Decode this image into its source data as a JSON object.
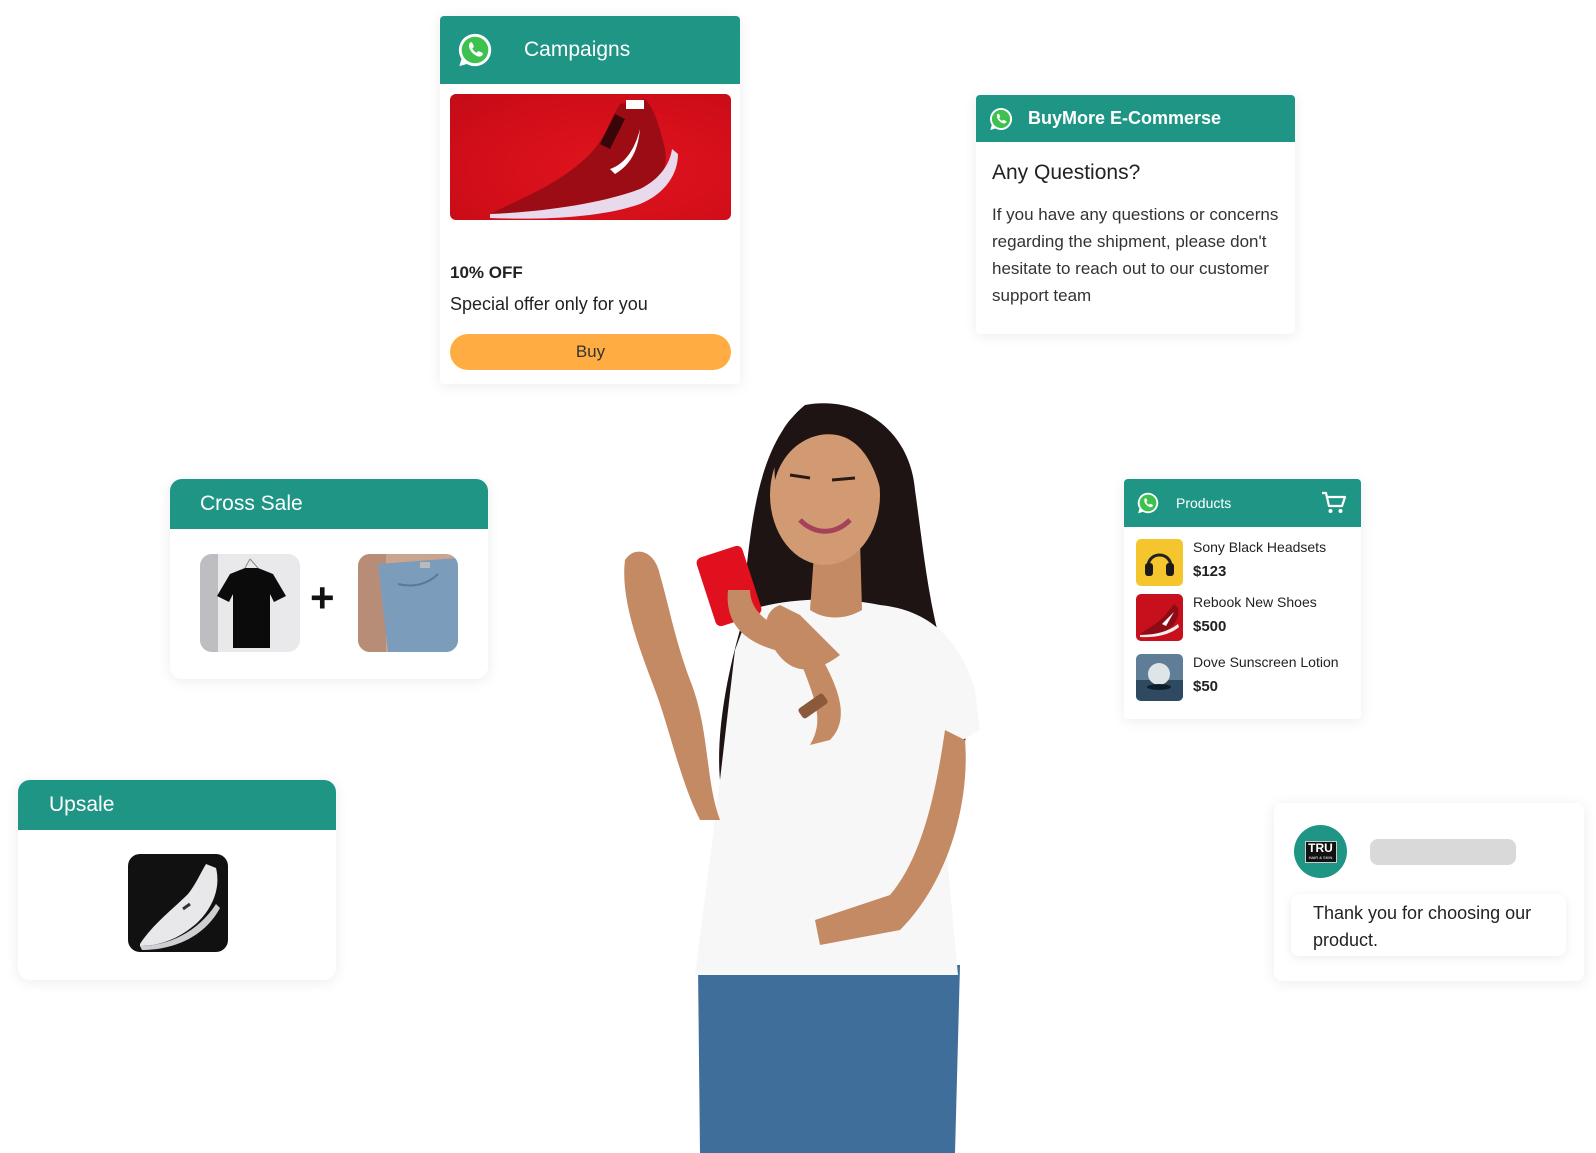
{
  "colors": {
    "brand_teal": "#1f9585",
    "whatsapp_green": "#3fc150",
    "buy_button": "#ffad42",
    "placeholder_gray": "#d9d9d9"
  },
  "campaigns": {
    "icon": "whatsapp-icon",
    "title": "Campaigns",
    "image": "red-running-shoe",
    "offer": "10% OFF",
    "subtitle": "Special offer only for you",
    "button_label": "Buy"
  },
  "buymore": {
    "icon": "whatsapp-icon",
    "title": "BuyMore E-Commerse",
    "heading": "Any Questions?",
    "body": "If you have any questions or concerns regarding the shipment, please don't hesitate to reach out to our customer support team"
  },
  "products": {
    "icon": "whatsapp-icon",
    "title": "Products",
    "cart_icon": "cart-icon",
    "items": [
      {
        "name": "Sony Black Headsets",
        "price": "$123",
        "thumb": "headphones"
      },
      {
        "name": "Rebook New Shoes",
        "price": "$500",
        "thumb": "red-shoe"
      },
      {
        "name": "Dove Sunscreen Lotion",
        "price": "$50",
        "thumb": "lotion-jar"
      }
    ]
  },
  "cross_sale": {
    "title": "Cross Sale",
    "items": [
      "black-tshirt",
      "blue-jeans"
    ],
    "joiner": "+"
  },
  "upsale": {
    "title": "Upsale",
    "item": "white-sneaker"
  },
  "thanks": {
    "avatar_text": "TRU",
    "avatar_subtext": "HAIR & SKIN",
    "message": "Thank you for choosing our product."
  },
  "hero": {
    "image": "woman-smiling-at-red-phone"
  }
}
